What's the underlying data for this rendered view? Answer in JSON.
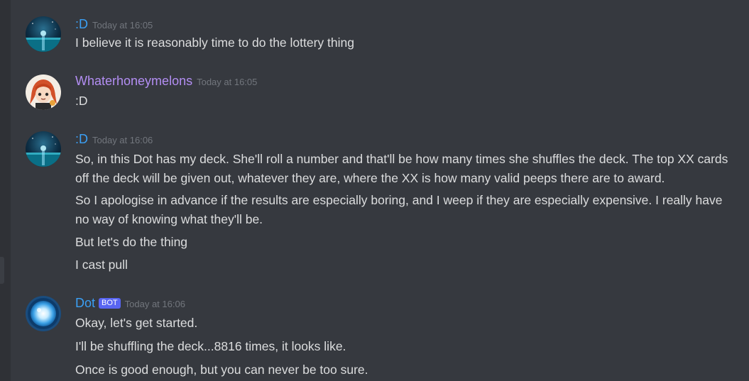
{
  "messages": [
    {
      "author": ":D",
      "author_color": "#3ba0f5",
      "avatar": "night-sea-icon",
      "timestamp": "Today at 16:05",
      "lines": [
        "I believe it is reasonably time to do the lottery thing"
      ]
    },
    {
      "author": "Whaterhoneymelons",
      "author_color": "#b38ef3",
      "avatar": "anime-character-icon",
      "timestamp": "Today at 16:05",
      "lines": [
        ":D"
      ]
    },
    {
      "author": ":D",
      "author_color": "#3ba0f5",
      "avatar": "night-sea-icon",
      "timestamp": "Today at 16:06",
      "lines": [
        "So, in this Dot has my deck. She'll roll a number and that'll be how many times she shuffles the deck. The top XX cards off the deck will be given out, whatever they are, where the XX is how many valid peeps there are to award.",
        "So I apologise in advance if the results are especially boring, and I weep if they are especially expensive. I really have no way of knowing what they'll be.",
        "But let's do the thing",
        "I cast pull"
      ]
    },
    {
      "author": "Dot",
      "author_color": "#3ba0f5",
      "avatar": "blue-orb-icon",
      "bot_tag": "BOT",
      "timestamp": "Today at 16:06",
      "lines": [
        "Okay, let's get started.",
        "I'll be shuffling the deck...8816 times, it looks like.",
        "Once is good enough, but you can never be too sure."
      ]
    }
  ]
}
